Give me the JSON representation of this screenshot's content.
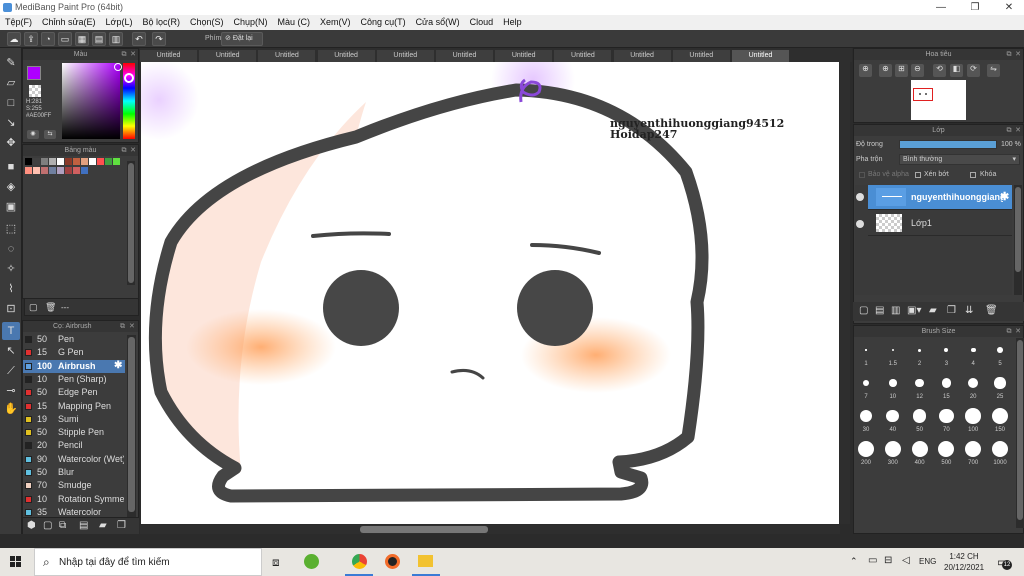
{
  "window": {
    "title": "MediBang Paint Pro (64bit)"
  },
  "menu": [
    "Tệp(F)",
    "Chỉnh sửa(E)",
    "Lớp(L)",
    "Bộ lọc(R)",
    "Chọn(S)",
    "Chụp(N)",
    "Màu (C)",
    "Xem(V)",
    "Công cụ(T)",
    "Cửa sổ(W)",
    "Cloud",
    "Help"
  ],
  "toolbar": {
    "phim_label": "Phím",
    "reset_label": "Đặt lại"
  },
  "color_panel": {
    "title": "Màu",
    "h": "H:281",
    "s": "S:255",
    "hex": "#AE00FF",
    "primary": "#ae00ff"
  },
  "palette_panel": {
    "title": "Bảng màu",
    "more": "---",
    "swatches": [
      "#000000",
      "#404040",
      "#7f7f7f",
      "#b0b0b0",
      "#ffffff",
      "#8a3a2a",
      "#c06040",
      "#e0a080",
      "#ffffff",
      "#ff5050",
      "#40a040",
      "#60e040",
      "#ff9080",
      "#ffc0b0",
      "#c07070",
      "#7080a0",
      "#b0a0c0",
      "#a04040",
      "#d06060",
      "#4070c0"
    ]
  },
  "brush_panel": {
    "title": "Cọ: Airbrush",
    "brushes": [
      {
        "size": "50",
        "name": "Pen",
        "color": "#222222"
      },
      {
        "size": "15",
        "name": "G Pen",
        "color": "#e03030"
      },
      {
        "size": "100",
        "name": "Airbrush",
        "color": "#60a0e0"
      },
      {
        "size": "10",
        "name": "Pen (Sharp)",
        "color": "#222222"
      },
      {
        "size": "50",
        "name": "Edge Pen",
        "color": "#e03030"
      },
      {
        "size": "15",
        "name": "Mapping Pen",
        "color": "#e03030"
      },
      {
        "size": "19",
        "name": "Sumi",
        "color": "#e0c020"
      },
      {
        "size": "50",
        "name": "Stipple Pen",
        "color": "#e0c020"
      },
      {
        "size": "20",
        "name": "Pencil",
        "color": "#222222"
      },
      {
        "size": "90",
        "name": "Watercolor (Wet)",
        "color": "#60c0e0"
      },
      {
        "size": "50",
        "name": "Blur",
        "color": "#60c0e0"
      },
      {
        "size": "70",
        "name": "Smudge",
        "color": "#f0d0c0"
      },
      {
        "size": "10",
        "name": "Rotation Symmetry",
        "color": "#e03030"
      },
      {
        "size": "35",
        "name": "Watercolor",
        "color": "#60c0e0"
      }
    ]
  },
  "tabs": [
    "Untitled",
    "Untitled",
    "Untitled",
    "Untitled",
    "Untitled",
    "Untitled",
    "Untitled",
    "Untitled",
    "Untitled",
    "Untitled",
    "Untitled"
  ],
  "canvas_text": {
    "line1": "nguyenthihuonggiang94512",
    "line2": "Hoidap247"
  },
  "navigator": {
    "title": "Hoa tiêu"
  },
  "layer_panel": {
    "title": "Lớp",
    "opacity_label": "Độ trong",
    "opacity_value": "100 %",
    "blend_label": "Pha trộn",
    "blend_value": "Bình thường",
    "protect_alpha": "Bảo vệ alpha",
    "clipping": "Xén bớt",
    "lock": "Khóa",
    "layers": [
      {
        "name": "nguyenthihuonggiang"
      },
      {
        "name": "Lớp1"
      }
    ]
  },
  "brush_size_panel": {
    "title": "Brush Size",
    "sizes": [
      "1",
      "1.5",
      "2",
      "3",
      "4",
      "5",
      "7",
      "10",
      "12",
      "15",
      "20",
      "25",
      "30",
      "40",
      "50",
      "70",
      "100",
      "150",
      "200",
      "300",
      "400",
      "500",
      "700",
      "1000"
    ]
  },
  "taskbar": {
    "search_placeholder": "Nhập tại đây để tìm kiếm",
    "lang": "ENG",
    "time": "1:42 CH",
    "date": "20/12/2021",
    "notif_count": "12"
  }
}
